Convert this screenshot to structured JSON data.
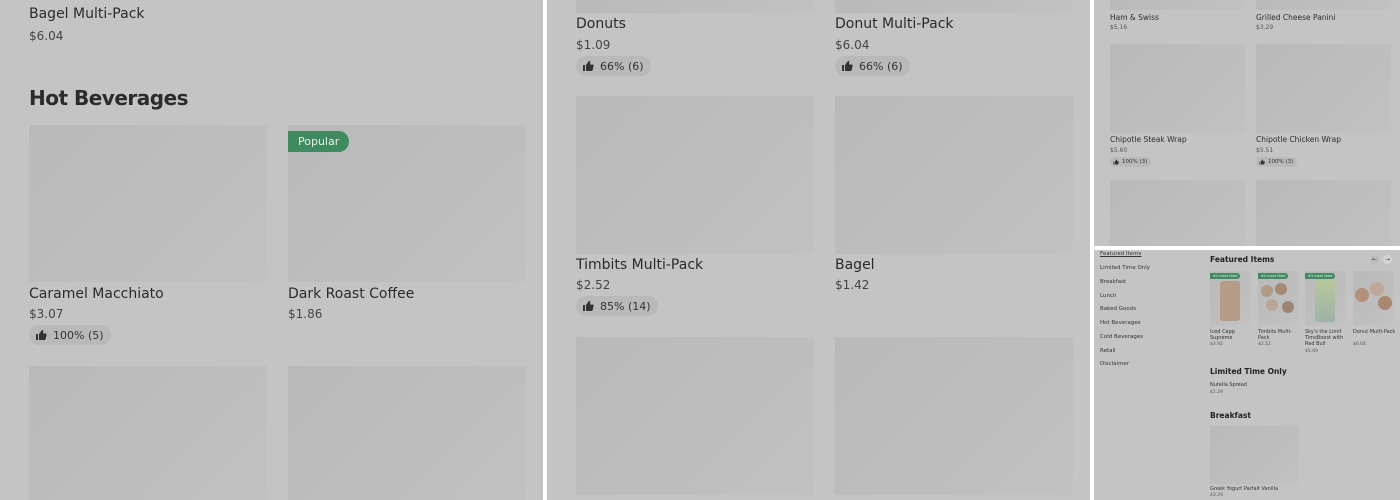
{
  "panel1": {
    "top_item": {
      "name": "Bagel Multi-Pack",
      "price": "$6.04"
    },
    "section_title": "Hot Beverages",
    "items": [
      {
        "name": "Caramel Macchiato",
        "price": "$3.07",
        "rating": "100% (5)"
      },
      {
        "name": "Dark Roast Coffee",
        "price": "$1.86",
        "badge": "Popular"
      }
    ]
  },
  "panel2": {
    "items": [
      {
        "name": "Donuts",
        "price": "$1.09",
        "rating": "66% (6)"
      },
      {
        "name": "Donut Multi-Pack",
        "price": "$6.04",
        "rating": "66% (6)"
      },
      {
        "name": "Timbits Multi-Pack",
        "price": "$2.52",
        "rating": "85% (14)"
      },
      {
        "name": "Bagel",
        "price": "$1.42"
      }
    ]
  },
  "panel3": {
    "items": [
      {
        "name": "Ham & Swiss",
        "price": "$5.16"
      },
      {
        "name": "Grilled Cheese Panini",
        "price": "$3.29"
      },
      {
        "name": "Chipotle Steak Wrap",
        "price": "$5.60",
        "rating": "100% (3)"
      },
      {
        "name": "Chipotle Chicken Wrap",
        "price": "$5.51",
        "rating": "100% (3)"
      }
    ]
  },
  "panel4": {
    "nav": [
      "Featured Items",
      "Limited Time Only",
      "Breakfast",
      "Lunch",
      "Baked Goods",
      "Hot Beverages",
      "Cold Beverages",
      "Retail",
      "Disclaimer"
    ],
    "featured_title": "Featured Items",
    "featured": [
      {
        "badge": "#1 most liked",
        "name": "Iced Capp Supreme",
        "price": "$3.92"
      },
      {
        "badge": "#2 most liked",
        "name": "Timbits Multi-Pack",
        "price": "$2.52"
      },
      {
        "badge": "#3 most liked",
        "name": "Sky's the Limit TimsBoost with Red Bull",
        "price": "$5.49"
      },
      {
        "name": "Donut Multi-Pack",
        "price": "$6.04"
      }
    ],
    "limited_title": "Limited Time Only",
    "limited_item": {
      "name": "Nutella Spread",
      "price": "$1.29"
    },
    "breakfast_title": "Breakfast",
    "breakfast_item": {
      "name": "Greek Yogurt Parfait Vanilla",
      "price": "$3.29"
    },
    "prev_icon": "←",
    "next_icon": "→"
  },
  "colors": {
    "overlay": "#c4c4c4",
    "badge_green": "#3f8a5f"
  }
}
